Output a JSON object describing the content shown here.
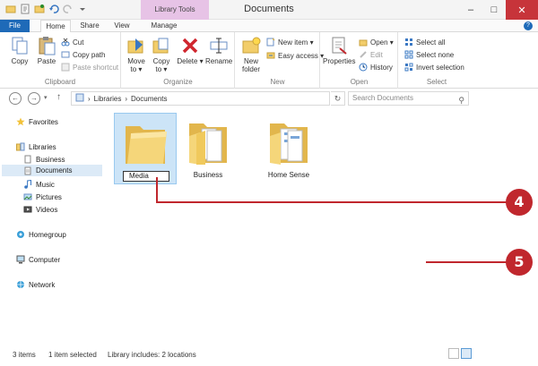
{
  "window": {
    "title": "Documents",
    "context_tab": "Library Tools",
    "controls": {
      "minimize": "–",
      "maximize": "□",
      "close": "✕"
    }
  },
  "tabs": {
    "file": "File",
    "home": "Home",
    "share": "Share",
    "view": "View",
    "manage": "Manage"
  },
  "ribbon": {
    "clipboard": {
      "label": "Clipboard",
      "copy": "Copy",
      "paste": "Paste",
      "cut": "Cut",
      "copy_path": "Copy path",
      "paste_shortcut": "Paste shortcut"
    },
    "organize": {
      "label": "Organize",
      "move_to": "Move to ▾",
      "copy_to": "Copy to ▾",
      "move_to_1": "Move",
      "move_to_2": "to ▾",
      "copy_to_1": "Copy",
      "copy_to_2": "to ▾",
      "delete": "Delete ▾",
      "rename": "Rename"
    },
    "new": {
      "label": "New",
      "new_folder_1": "New",
      "new_folder_2": "folder",
      "new_item": "New item ▾",
      "easy_access": "Easy access ▾"
    },
    "open": {
      "label": "Open",
      "properties": "Properties",
      "open": "Open ▾",
      "edit": "Edit",
      "history": "History"
    },
    "select": {
      "label": "Select",
      "select_all": "Select all",
      "select_none": "Select none",
      "invert_selection": "Invert selection"
    }
  },
  "address": {
    "crumb_sep": "›",
    "crumb_1": "Libraries",
    "crumb_2": "Documents",
    "search_placeholder": "Search Documents"
  },
  "nav_pane": {
    "favorites": "Favorites",
    "libraries": "Libraries",
    "business": "Business",
    "documents": "Documents",
    "music": "Music",
    "pictures": "Pictures",
    "videos": "Videos",
    "homegroup": "Homegroup",
    "computer": "Computer",
    "network": "Network"
  },
  "items": [
    {
      "name": "Media",
      "state": "renaming"
    },
    {
      "name": "Business",
      "state": "normal"
    },
    {
      "name": "Home Sense",
      "state": "normal"
    }
  ],
  "status": {
    "count": "3 items",
    "selected": "1 item selected",
    "library": "Library includes: 2 locations"
  },
  "callouts": {
    "a": "4",
    "b": "5"
  },
  "colors": {
    "accent": "#1e6ab8",
    "context_tab": "#e7c3e6",
    "close": "#c7343a",
    "callout": "#c0272d",
    "selection": "#cce4f7",
    "folder": "#f2cd6a"
  }
}
